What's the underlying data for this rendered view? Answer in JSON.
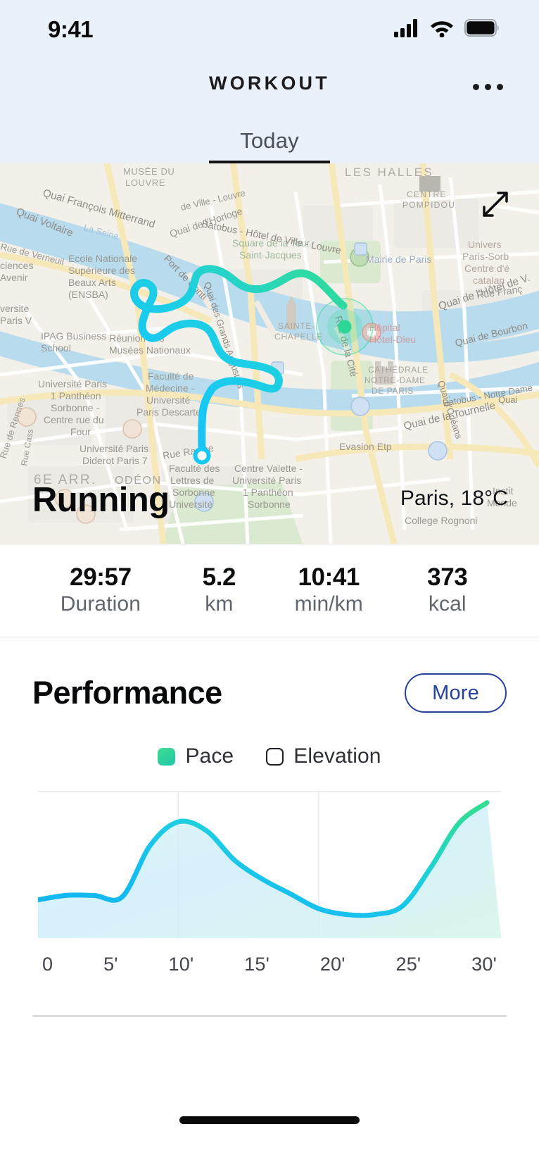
{
  "status_bar": {
    "time": "9:41",
    "cellular_icon": "cellular-signal-icon",
    "wifi_icon": "wifi-icon",
    "battery_icon": "battery-icon"
  },
  "nav": {
    "title": "WORKOUT",
    "more_icon": "overflow-menu-icon"
  },
  "tabs": [
    {
      "label": "Today",
      "active": true
    }
  ],
  "map": {
    "expand_icon": "expand-arrows-icon",
    "activity_title": "Running",
    "weather": "Paris, 18°C",
    "route_start_color": "#19c6f2",
    "route_end_color": "#2fd99a",
    "labels": [
      "MUSÉE DU LOUVRE",
      "Quai François Mitterrand",
      "La Seine",
      "Quai Voltaire",
      "Rue de Verneuil",
      "Ecole Nationale Supérieure des Beaux Arts (ENSBA)",
      "Port de Conti",
      "Sciences Po Avenir",
      "Université Paris V",
      "IPAG Business School",
      "Réunion des Musées Nationaux",
      "Université Paris 1 Panthéon Sorbonne - Centre rue du Four",
      "Université Paris Diderot Paris 7",
      "6E ARR.",
      "ODÉON",
      "Rue de Rennes",
      "Rue Cass",
      "Faculté de Médecine - Université Paris Descartes",
      "Rue Racine",
      "Faculté des Lettres de Sorbonne Université",
      "Centre Valette - Université Paris 1 Panthéon Sorbonne",
      "Evasion Etp",
      "College Rognoni",
      "Institut Monde",
      "LES HALLES",
      "CENTRE POMPIDOU",
      "Square de la Tour Saint-Jacques",
      "Mairie de Paris",
      "Quai de l'Horloge",
      "SAINTE-CHAPELLE",
      "Rue de la Cité",
      "Hôpital Hôtel-Dieu",
      "Quai de l'Hôtel de V.",
      "Quai de Bourbon",
      "Quai d'Orléans",
      "Batobus - Notre Dame",
      "Quai de la Tournelle",
      "Batobus - Hôtel de Ville - Louvre",
      "Quai des Grands Augustins",
      "Universit Paris-Sorb Centre d'é catalan",
      "Rue Franç"
    ]
  },
  "stats": [
    {
      "value": "29:57",
      "label": "Duration"
    },
    {
      "value": "5.2",
      "label": "km"
    },
    {
      "value": "10:41",
      "label": "min/km"
    },
    {
      "value": "373",
      "label": "kcal"
    }
  ],
  "performance": {
    "title": "Performance",
    "more_label": "More",
    "legend": [
      {
        "label": "Pace",
        "selected": true,
        "color": "#2fd99a"
      },
      {
        "label": "Elevation",
        "selected": false,
        "color": "#ffffff"
      }
    ]
  },
  "chart_data": {
    "type": "area",
    "title": "Performance",
    "xlabel": "",
    "ylabel": "",
    "grid": true,
    "legend_position": "top-center",
    "xticks": [
      "0",
      "5'",
      "10'",
      "15'",
      "20'",
      "25'",
      "30'"
    ],
    "xlim": [
      0,
      33
    ],
    "ylim": [
      0,
      100
    ],
    "series": [
      {
        "name": "Pace",
        "color_low": "#19bdf0",
        "color_high": "#2fd99a",
        "x": [
          0,
          2,
          4,
          6,
          8,
          10,
          12,
          14,
          16,
          18,
          20,
          22,
          24,
          26,
          28,
          30,
          32
        ],
        "values": [
          26,
          29,
          29,
          28,
          63,
          79,
          73,
          53,
          40,
          30,
          20,
          16,
          16,
          22,
          48,
          78,
          92
        ]
      }
    ]
  },
  "home_indicator": "home-indicator"
}
